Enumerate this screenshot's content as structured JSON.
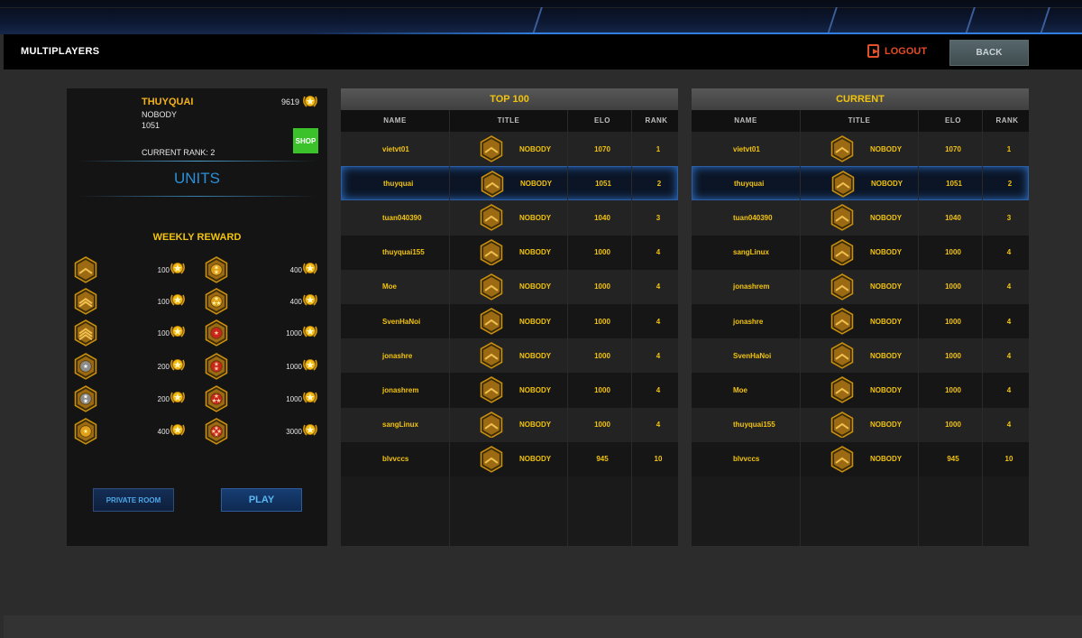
{
  "header": {
    "title": "MULTIPLAYERS",
    "logout_label": "LOGOUT",
    "back_label": "BACK"
  },
  "user": {
    "name": "THUYQUAI",
    "title": "NOBODY",
    "elo": "1051",
    "coins": "9619",
    "shop_label": "SHOP",
    "current_rank": "CURRENT RANK: 2"
  },
  "units_label": "UNITS",
  "weekly_label": "WEEKLY REWARD",
  "rewards_left": [
    "100",
    "100",
    "100",
    "200",
    "200",
    "400"
  ],
  "rewards_right": [
    "400",
    "400",
    "1000",
    "1000",
    "1000",
    "3000"
  ],
  "buttons": {
    "private_room": "PRIVATE ROOM",
    "play": "PLAY"
  },
  "columns": [
    "NAME",
    "TITLE",
    "ELO",
    "RANK"
  ],
  "top100": {
    "title": "TOP 100",
    "rows": [
      {
        "name": "vietvt01",
        "title": "NOBODY",
        "elo": "1070",
        "rank": "1"
      },
      {
        "name": "thuyquai",
        "title": "NOBODY",
        "elo": "1051",
        "rank": "2"
      },
      {
        "name": "tuan040390",
        "title": "NOBODY",
        "elo": "1040",
        "rank": "3"
      },
      {
        "name": "thuyquai155",
        "title": "NOBODY",
        "elo": "1000",
        "rank": "4"
      },
      {
        "name": "Moe",
        "title": "NOBODY",
        "elo": "1000",
        "rank": "4"
      },
      {
        "name": "SvenHaNoi",
        "title": "NOBODY",
        "elo": "1000",
        "rank": "4"
      },
      {
        "name": "jonashre",
        "title": "NOBODY",
        "elo": "1000",
        "rank": "4"
      },
      {
        "name": "jonashrem",
        "title": "NOBODY",
        "elo": "1000",
        "rank": "4"
      },
      {
        "name": "sangLinux",
        "title": "NOBODY",
        "elo": "1000",
        "rank": "4"
      },
      {
        "name": "blvvccs",
        "title": "NOBODY",
        "elo": "945",
        "rank": "10"
      }
    ]
  },
  "current": {
    "title": "CURRENT",
    "rows": [
      {
        "name": "vietvt01",
        "title": "NOBODY",
        "elo": "1070",
        "rank": "1"
      },
      {
        "name": "thuyquai",
        "title": "NOBODY",
        "elo": "1051",
        "rank": "2"
      },
      {
        "name": "tuan040390",
        "title": "NOBODY",
        "elo": "1040",
        "rank": "3"
      },
      {
        "name": "sangLinux",
        "title": "NOBODY",
        "elo": "1000",
        "rank": "4"
      },
      {
        "name": "jonashrem",
        "title": "NOBODY",
        "elo": "1000",
        "rank": "4"
      },
      {
        "name": "jonashre",
        "title": "NOBODY",
        "elo": "1000",
        "rank": "4"
      },
      {
        "name": "SvenHaNoi",
        "title": "NOBODY",
        "elo": "1000",
        "rank": "4"
      },
      {
        "name": "Moe",
        "title": "NOBODY",
        "elo": "1000",
        "rank": "4"
      },
      {
        "name": "thuyquai155",
        "title": "NOBODY",
        "elo": "1000",
        "rank": "4"
      },
      {
        "name": "blvvccs",
        "title": "NOBODY",
        "elo": "945",
        "rank": "10"
      }
    ]
  },
  "selected_row_index": 1,
  "colors": {
    "accent_gold": "#f2c30d",
    "accent_blue": "#2b8fd8",
    "logout_red": "#e34b27",
    "shop_green": "#3bc22b"
  }
}
